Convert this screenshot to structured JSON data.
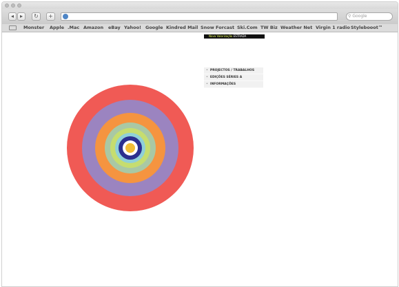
{
  "browser": {
    "search_placeholder": "Google",
    "bookmarks": [
      "Monster",
      "Apple",
      ".Mac",
      "Amazon",
      "eBay",
      "Yahoo!",
      "Google",
      "Kindred Mail",
      "Snow Forcast",
      "Ski.Com",
      "TW Biz",
      "Weather Net",
      "Virgin 1 radio",
      "Stylebooot™"
    ]
  },
  "page": {
    "promo": {
      "text": "Nova Valorização",
      "highlight": "ESTRADA"
    },
    "menu": [
      {
        "label": "PROJECTOS / TRABALHOS"
      },
      {
        "label": "EDIÇÕES SÉRIES A"
      },
      {
        "label": "INFORMAÇÕES"
      }
    ]
  },
  "colors": {
    "ring_colors": [
      "#f05a55",
      "#9b84c0",
      "#f59440",
      "#a9c8a4",
      "#c6dd6f",
      "#8fd0d8",
      "#2c2f8f",
      "#ffffff",
      "#f2bd36"
    ]
  }
}
